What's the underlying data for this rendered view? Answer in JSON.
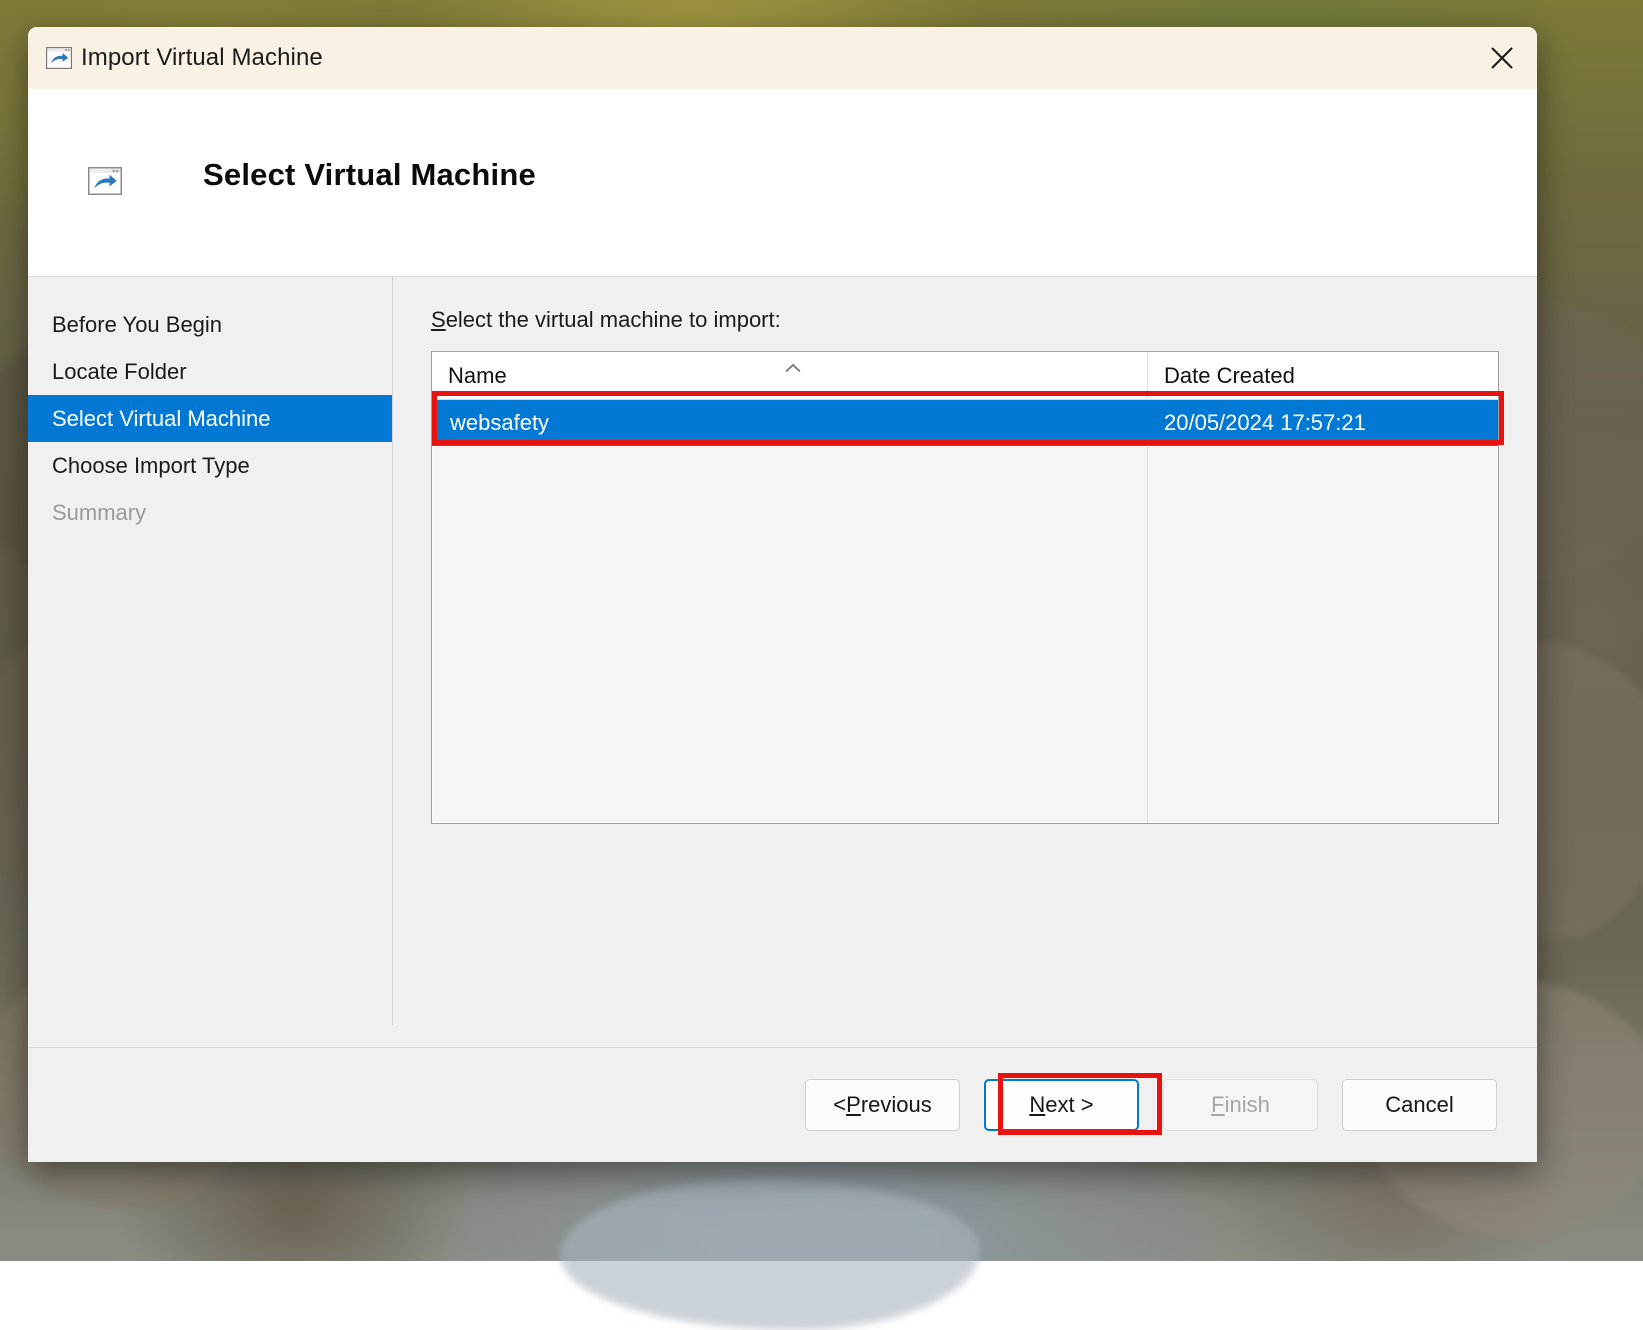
{
  "window": {
    "title": "Import Virtual Machine",
    "icon": "import-vm-icon",
    "close_label": "✕"
  },
  "header": {
    "icon": "import-vm-icon",
    "title": "Select Virtual Machine"
  },
  "sidebar": {
    "items": [
      {
        "label": "Before You Begin",
        "state": "normal"
      },
      {
        "label": "Locate Folder",
        "state": "normal"
      },
      {
        "label": "Select Virtual Machine",
        "state": "selected"
      },
      {
        "label": "Choose Import Type",
        "state": "normal"
      },
      {
        "label": "Summary",
        "state": "disabled"
      }
    ]
  },
  "content": {
    "prompt_accelerator": "S",
    "prompt_rest": "elect the virtual machine to import:",
    "listview": {
      "columns": [
        {
          "key": "name",
          "label": "Name",
          "sort": "ascending"
        },
        {
          "key": "date",
          "label": "Date Created",
          "sort": "none"
        }
      ],
      "rows": [
        {
          "name": "websafety",
          "date": "20/05/2024 17:57:21",
          "selected": true
        }
      ]
    }
  },
  "footer": {
    "buttons": [
      {
        "id": "previous",
        "prefix": "< ",
        "accelerator": "P",
        "rest": "revious",
        "state": "normal"
      },
      {
        "id": "next",
        "prefix": "",
        "accelerator": "N",
        "rest": "ext >",
        "state": "default"
      },
      {
        "id": "finish",
        "prefix": "",
        "accelerator": "F",
        "rest": "inish",
        "state": "disabled"
      },
      {
        "id": "cancel",
        "prefix": "",
        "accelerator": "",
        "rest": "Cancel",
        "state": "normal"
      }
    ]
  },
  "annotations": {
    "color": "#e8120f",
    "boxes": [
      {
        "target": "listview-row-websafety"
      },
      {
        "target": "next-button"
      }
    ]
  },
  "colors": {
    "titlebar": "#f9f1e3",
    "accent": "#0078d4",
    "body": "#f0f0f0",
    "annotation": "#e8120f"
  }
}
